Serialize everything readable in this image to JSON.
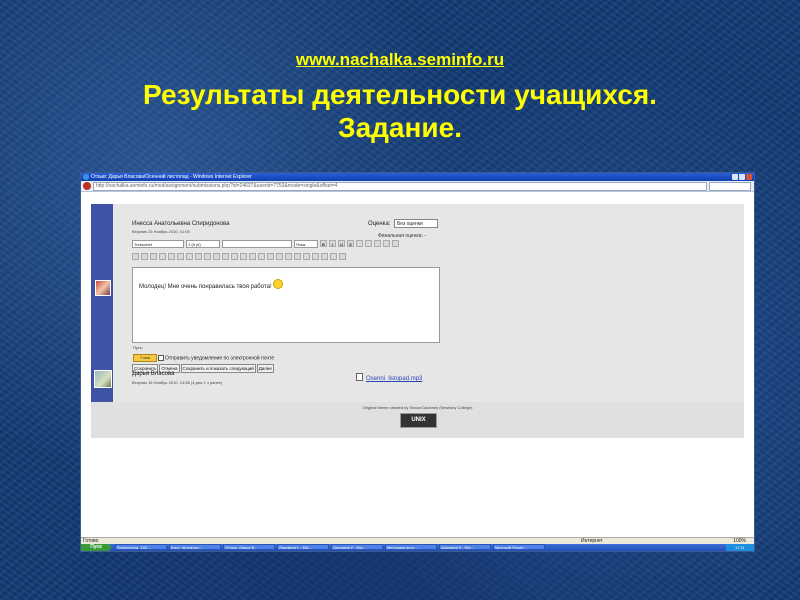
{
  "slide": {
    "link": "www.nachalka.seminfo.ru",
    "title_line1": "Результаты деятельности учащихся.",
    "title_line2": "Задание."
  },
  "browser": {
    "window_title": "Отзыв: Дарья Власова/Осенний листопад - Windows Internet Explorer",
    "url": "http://nachalka.seminfo.ru/mod/assignment/submissions.php?id=24637&userid=7753&mode=single&offset=4"
  },
  "feedback": {
    "teacher_name": "Инесса Анатольевна Спиридонова",
    "teacher_date": "Вторник 23 Ноябрь 2010, 01:05",
    "grade_label": "Оценка:",
    "grade_value": "Без оценки",
    "final_grade_label": "Финальная оценка: -",
    "font_family_value": "Trebuchet",
    "font_size_value": "1 (8 pt)",
    "lang_value": "Язык",
    "comment_text": "Молодец! Мне очень понравилась твоя работа!",
    "path_label": "Путь:",
    "help_button": "? ино",
    "notify_label": "Отправить уведомление по электронной почте",
    "buttons": [
      "Сохранить",
      "Отмена",
      "Сохранить и показать следующий",
      "Далее"
    ]
  },
  "submission": {
    "student_name": "Дарья Власова",
    "student_date": "Вторник 16 Ноябрь 2010, 14:38 (4 дня 1 ч ранее)",
    "file_name": "Osenni_listopad.mp3"
  },
  "footer": {
    "credit": "Original theme created by Shaun Daubney (Newbury College)",
    "logo": "UNIX"
  },
  "statusbar": {
    "left": "Готово",
    "zone": "Интернет",
    "zoom": "100%"
  },
  "taskbar": {
    "start": "Пуск",
    "tasks": [
      "Spiridonova_102...",
      "Курс: Актуальн...",
      "Отзыв: Дарья В...",
      "Документ1 - Mic...",
      "Документ2 - Mic...",
      "Методика исто...",
      "Документ3 - Mic...",
      "Microsoft Power..."
    ],
    "clock": "17:11"
  }
}
